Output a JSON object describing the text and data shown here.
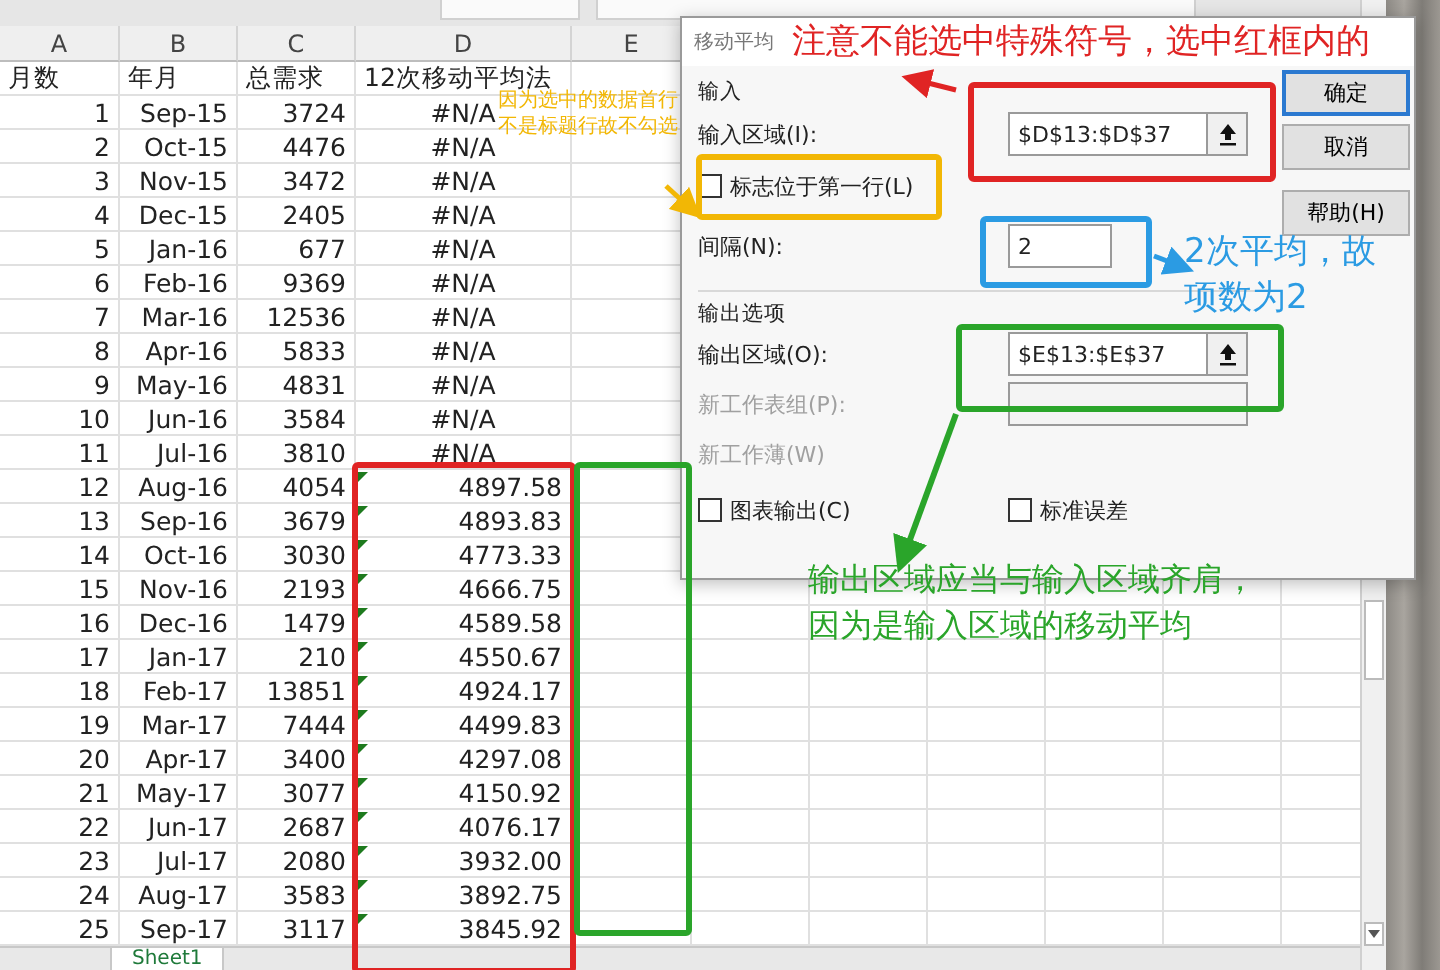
{
  "sheet": {
    "columns": [
      "A",
      "B",
      "C",
      "D",
      "E"
    ],
    "header_row": [
      "月数",
      "年月",
      "总需求",
      "12次移动平均法"
    ],
    "rows": [
      {
        "cells": [
          "1",
          "Sep-15",
          "3724",
          "#N/A"
        ],
        "flagged": false
      },
      {
        "cells": [
          "2",
          "Oct-15",
          "4476",
          "#N/A"
        ],
        "flagged": false
      },
      {
        "cells": [
          "3",
          "Nov-15",
          "3472",
          "#N/A"
        ],
        "flagged": false
      },
      {
        "cells": [
          "4",
          "Dec-15",
          "2405",
          "#N/A"
        ],
        "flagged": false
      },
      {
        "cells": [
          "5",
          "Jan-16",
          "677",
          "#N/A"
        ],
        "flagged": false
      },
      {
        "cells": [
          "6",
          "Feb-16",
          "9369",
          "#N/A"
        ],
        "flagged": false
      },
      {
        "cells": [
          "7",
          "Mar-16",
          "12536",
          "#N/A"
        ],
        "flagged": false
      },
      {
        "cells": [
          "8",
          "Apr-16",
          "5833",
          "#N/A"
        ],
        "flagged": false
      },
      {
        "cells": [
          "9",
          "May-16",
          "4831",
          "#N/A"
        ],
        "flagged": false
      },
      {
        "cells": [
          "10",
          "Jun-16",
          "3584",
          "#N/A"
        ],
        "flagged": false
      },
      {
        "cells": [
          "11",
          "Jul-16",
          "3810",
          "#N/A"
        ],
        "flagged": false
      },
      {
        "cells": [
          "12",
          "Aug-16",
          "4054",
          "4897.58"
        ],
        "flagged": true
      },
      {
        "cells": [
          "13",
          "Sep-16",
          "3679",
          "4893.83"
        ],
        "flagged": true
      },
      {
        "cells": [
          "14",
          "Oct-16",
          "3030",
          "4773.33"
        ],
        "flagged": true
      },
      {
        "cells": [
          "15",
          "Nov-16",
          "2193",
          "4666.75"
        ],
        "flagged": true
      },
      {
        "cells": [
          "16",
          "Dec-16",
          "1479",
          "4589.58"
        ],
        "flagged": true
      },
      {
        "cells": [
          "17",
          "Jan-17",
          "210",
          "4550.67"
        ],
        "flagged": true
      },
      {
        "cells": [
          "18",
          "Feb-17",
          "13851",
          "4924.17"
        ],
        "flagged": true
      },
      {
        "cells": [
          "19",
          "Mar-17",
          "7444",
          "4499.83"
        ],
        "flagged": true
      },
      {
        "cells": [
          "20",
          "Apr-17",
          "3400",
          "4297.08"
        ],
        "flagged": true
      },
      {
        "cells": [
          "21",
          "May-17",
          "3077",
          "4150.92"
        ],
        "flagged": true
      },
      {
        "cells": [
          "22",
          "Jun-17",
          "2687",
          "4076.17"
        ],
        "flagged": true
      },
      {
        "cells": [
          "23",
          "Jul-17",
          "2080",
          "3932.00"
        ],
        "flagged": true
      },
      {
        "cells": [
          "24",
          "Aug-17",
          "3583",
          "3892.75"
        ],
        "flagged": true
      },
      {
        "cells": [
          "25",
          "Sep-17",
          "3117",
          "3845.92"
        ],
        "flagged": true
      }
    ],
    "sheet_tab": "Sheet1"
  },
  "dialog": {
    "title": "移动平均",
    "input_group": "输入",
    "input_range": {
      "label": "输入区域(I):",
      "value": "$D$13:$D$37"
    },
    "labels_checkbox": {
      "label": "标志位于第一行(L)",
      "checked": false
    },
    "interval": {
      "label": "间隔(N):",
      "value": "2"
    },
    "output_group": "输出选项",
    "output_range": {
      "label": "输出区域(O):",
      "value": "$E$13:$E$37"
    },
    "new_sheet": {
      "label": "新工作表组(P):",
      "disabled": true
    },
    "new_workbook": {
      "label": "新工作薄(W)",
      "disabled": true
    },
    "options": [
      {
        "label": "图表输出(C)",
        "checked": false
      },
      {
        "label": "标准误差",
        "checked": false
      }
    ],
    "buttons": [
      {
        "label": "确定",
        "default": true
      },
      {
        "label": "取消",
        "default": false
      },
      {
        "label": "帮助(H)",
        "default": false
      }
    ]
  },
  "annotations": [
    {
      "color": "#e02424",
      "lines": [
        "注意不能选中特殊符号，选中红框内的"
      ]
    },
    {
      "color": "#f2b705",
      "lines": [
        "因为选中的数据首行",
        "不是标题行故不勾选"
      ]
    },
    {
      "color": "#2b9be3",
      "lines": [
        "2次平均，故",
        "项数为2"
      ]
    },
    {
      "color": "#2aa52a",
      "lines": [
        "输出区域应当与输入区域齐肩，",
        "因为是输入区域的移动平均"
      ]
    }
  ]
}
